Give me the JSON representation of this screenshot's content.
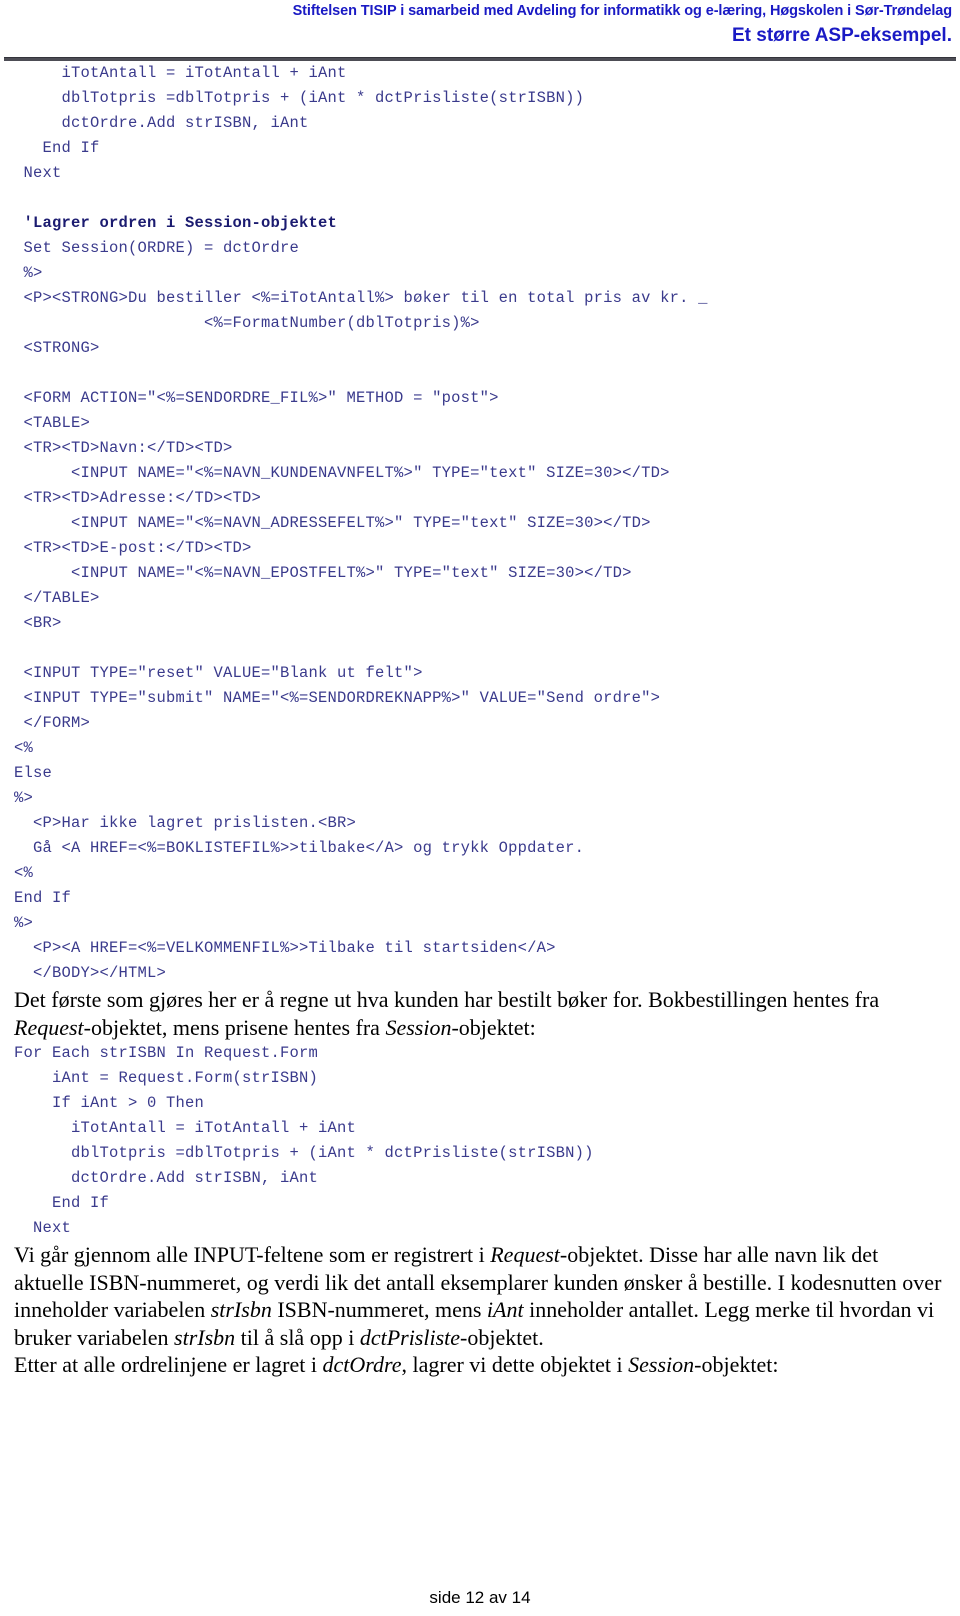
{
  "header": {
    "line1": "Stiftelsen TISIP i samarbeid med Avdeling for informatikk og e-læring, Høgskolen i Sør-Trøndelag",
    "line2": "Et større ASP-eksempel.",
    "accent_color": "#1a1ac4",
    "rule_color": "#4d4d55"
  },
  "code_block_1": {
    "language": "asp-vbscript",
    "text_color": "#3a3a8c",
    "comment_color": "#1b1b70",
    "lines": [
      "     iTotAntall = iTotAntall + iAnt",
      "     dblTotpris =dblTotpris + (iAnt * dctPrisliste(strISBN))",
      "     dctOrdre.Add strISBN, iAnt",
      "   End If",
      " Next",
      "",
      " 'Lagrer ordren i Session-objektet",
      " Set Session(ORDRE) = dctOrdre",
      " %>",
      " <P><STRONG>Du bestiller <%=iTotAntall%> bøker til en total pris av kr. _",
      "                    <%=FormatNumber(dblTotpris)%>",
      " <STRONG>",
      "",
      " <FORM ACTION=\"<%=SENDORDRE_FIL%>\" METHOD = \"post\">",
      " <TABLE>",
      " <TR><TD>Navn:</TD><TD>",
      "      <INPUT NAME=\"<%=NAVN_KUNDENAVNFELT%>\" TYPE=\"text\" SIZE=30></TD>",
      " <TR><TD>Adresse:</TD><TD>",
      "      <INPUT NAME=\"<%=NAVN_ADRESSEFELT%>\" TYPE=\"text\" SIZE=30></TD>",
      " <TR><TD>E-post:</TD><TD>",
      "      <INPUT NAME=\"<%=NAVN_EPOSTFELT%>\" TYPE=\"text\" SIZE=30></TD>",
      " </TABLE>",
      " <BR>",
      "",
      " <INPUT TYPE=\"reset\" VALUE=\"Blank ut felt\">",
      " <INPUT TYPE=\"submit\" NAME=\"<%=SENDORDREKNAPP%>\" VALUE=\"Send ordre\">",
      " </FORM>",
      "<%",
      "Else",
      "%>",
      "  <P>Har ikke lagret prislisten.<BR>",
      "  Gå <A HREF=<%=BOKLISTEFIL%>>tilbake</A> og trykk Oppdater.",
      "<%",
      "End If",
      "%>",
      "  <P><A HREF=<%=VELKOMMENFIL%>>Tilbake til startsiden</A>",
      "  </BODY></HTML>"
    ],
    "comment_line_index": 6
  },
  "paragraph_1": {
    "runs": [
      {
        "text": "Det første som gjøres her er å regne ut hva kunden har bestilt bøker for. Bokbestillingen hentes fra ",
        "style": "normal"
      },
      {
        "text": "Request",
        "style": "italic"
      },
      {
        "text": "-objektet, mens prisene hentes fra ",
        "style": "normal"
      },
      {
        "text": "Session",
        "style": "italic"
      },
      {
        "text": "-objektet:",
        "style": "normal"
      }
    ]
  },
  "code_block_2": {
    "language": "asp-vbscript",
    "lines": [
      "For Each strISBN In Request.Form",
      "    iAnt = Request.Form(strISBN)",
      "    If iAnt > 0 Then",
      "      iTotAntall = iTotAntall + iAnt",
      "      dblTotpris =dblTotpris + (iAnt * dctPrisliste(strISBN))",
      "      dctOrdre.Add strISBN, iAnt",
      "    End If",
      "  Next"
    ]
  },
  "paragraph_2": {
    "runs": [
      {
        "text": "Vi går gjennom alle INPUT-feltene som er registrert i ",
        "style": "normal"
      },
      {
        "text": "Request",
        "style": "italic"
      },
      {
        "text": "-objektet. Disse har alle navn lik det aktuelle ISBN-nummeret, og verdi lik det antall eksemplarer kunden ønsker å bestille. I kodesnutten over inneholder variabelen ",
        "style": "normal"
      },
      {
        "text": "strIsbn",
        "style": "italic"
      },
      {
        "text": " ISBN-nummeret, mens ",
        "style": "normal"
      },
      {
        "text": "iAnt",
        "style": "italic"
      },
      {
        "text": " inneholder antallet. Legg merke til hvordan vi bruker variabelen ",
        "style": "normal"
      },
      {
        "text": "strIsbn",
        "style": "italic"
      },
      {
        "text": " til å slå opp i ",
        "style": "normal"
      },
      {
        "text": "dctPrisliste",
        "style": "italic"
      },
      {
        "text": "-objektet.",
        "style": "normal"
      }
    ]
  },
  "paragraph_3": {
    "runs": [
      {
        "text": "Etter at alle ordrelinjene er lagret i ",
        "style": "normal"
      },
      {
        "text": "dctOrdre",
        "style": "italic"
      },
      {
        "text": ", lagrer vi dette objektet i ",
        "style": "normal"
      },
      {
        "text": "Session",
        "style": "italic"
      },
      {
        "text": "-objektet:",
        "style": "normal"
      }
    ]
  },
  "footer": {
    "page_label": "side 12 av 14"
  }
}
